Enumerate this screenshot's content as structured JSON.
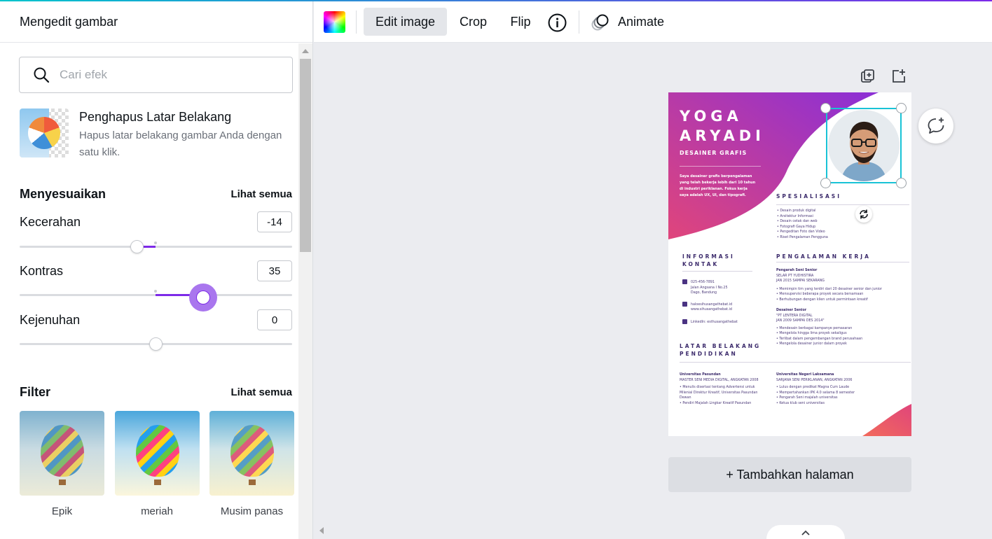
{
  "panel": {
    "title": "Mengedit gambar",
    "search": {
      "placeholder": "Cari efek",
      "value": ""
    },
    "bg_remover": {
      "title": "Penghapus Latar Belakang",
      "description": "Hapus latar belakang gambar Anda dengan satu klik."
    },
    "adjust": {
      "heading": "Menyesuaikan",
      "see_all": "Lihat semua",
      "brightness": {
        "label": "Kecerahan",
        "value": "-14"
      },
      "contrast": {
        "label": "Kontras",
        "value": "35"
      },
      "saturation": {
        "label": "Kejenuhan",
        "value": "0"
      }
    },
    "filter": {
      "heading": "Filter",
      "see_all": "Lihat semua",
      "items": [
        {
          "label": "Epik"
        },
        {
          "label": "meriah"
        },
        {
          "label": "Musim panas"
        }
      ]
    }
  },
  "toolbar": {
    "edit_image": "Edit image",
    "crop": "Crop",
    "flip": "Flip",
    "animate": "Animate"
  },
  "canvas": {
    "add_page": "+ Tambahkan halaman"
  },
  "resume": {
    "first_name": "YOGA",
    "last_name": "ARYADI",
    "role": "DESAINER GRAFIS",
    "intro": "Saya desainer grafis berpengalaman yang telah bekerja lebih dari 10 tahun di industri periklanan. Fokus kerja saya adalah UX, UI, dan tipografi.",
    "spec_title": "SPESIALISASI",
    "spec_items": [
      "Desain produk digital",
      "Arsitektur Informasi",
      "Desain cetak dan web",
      "Fotografi Gaya Hidup",
      "Pengeditan Foto dan Video",
      "Riset Pengalaman Pengguna"
    ],
    "contact_title_1": "INFORMASI",
    "contact_title_2": "KONTAK",
    "contact_phone": "025-456-7891",
    "contact_addr_1": "Jalan Angsana I No.25",
    "contact_addr_2": "Dago, Bandung",
    "contact_mail_1": "haloesihusangathebat.id",
    "contact_mail_2": "www.sihusangathebat.id",
    "contact_linkedin": "LinkedIn: esthusangathebat",
    "exp_title": "PENGALAMAN KERJA",
    "exp1_title": "Pengarah Seni Senior",
    "exp1_co": "SELAR PT YUDHISTIRA",
    "exp1_date": "JAN 2015 SAMPAI SEKARANG",
    "exp1_items": [
      "Memimpin tim yang terdiri dari 20 desainer senior dan junior",
      "Mensupervisi beberapa proyek secara bersamaan",
      "Berhubungan dengan klien untuk permintaan kreatif"
    ],
    "exp2_title": "Desainer Senior",
    "exp2_co": "\"PT LENTERA DIGITAL",
    "exp2_date": "JAN 2009 SAMPAI DES 2014\"",
    "exp2_items": [
      "Mendesain berbagai kampanye pemasaran",
      "Mengelola hingga lima proyek sekaligus",
      "Terlibat dalam pengembangan brand perusahaan",
      "Mengelola desainer junior dalam proyek"
    ],
    "edu_title_1": "LATAR BELAKANG",
    "edu_title_2": "PENDIDIKAN",
    "edu1_school": "Universitas Pasundan",
    "edu1_degree": "MASTER SENI MEDIA DIGITAL, ANGKATAN 2008",
    "edu1_items": [
      "Menulis disertasi tentang Advertensi untuk Milenial Direktur Kreatif, Universitas Pasundan Dewan",
      "Pendiri Majalah Lingkar Kreatif Pasundan"
    ],
    "edu2_school": "Universitas Negeri Laksamana",
    "edu2_degree": "SARJANA SENI PERIKLANAN, ANGKATAN 2006",
    "edu2_items": [
      "Lulus dengan predikat Magna Cum Laude",
      "Mempertahankan IPK 4.0 selama 8 semester",
      "Pengarah Seni majalah universitas",
      "Ketua klub seni universitas"
    ]
  },
  "colors": {
    "accent": "#7d2ae8",
    "selection": "#19c3d6",
    "resume_grad_start": "#e0457b",
    "resume_grad_end": "#8b2fd6",
    "resume_text": "#3b2a6b"
  }
}
